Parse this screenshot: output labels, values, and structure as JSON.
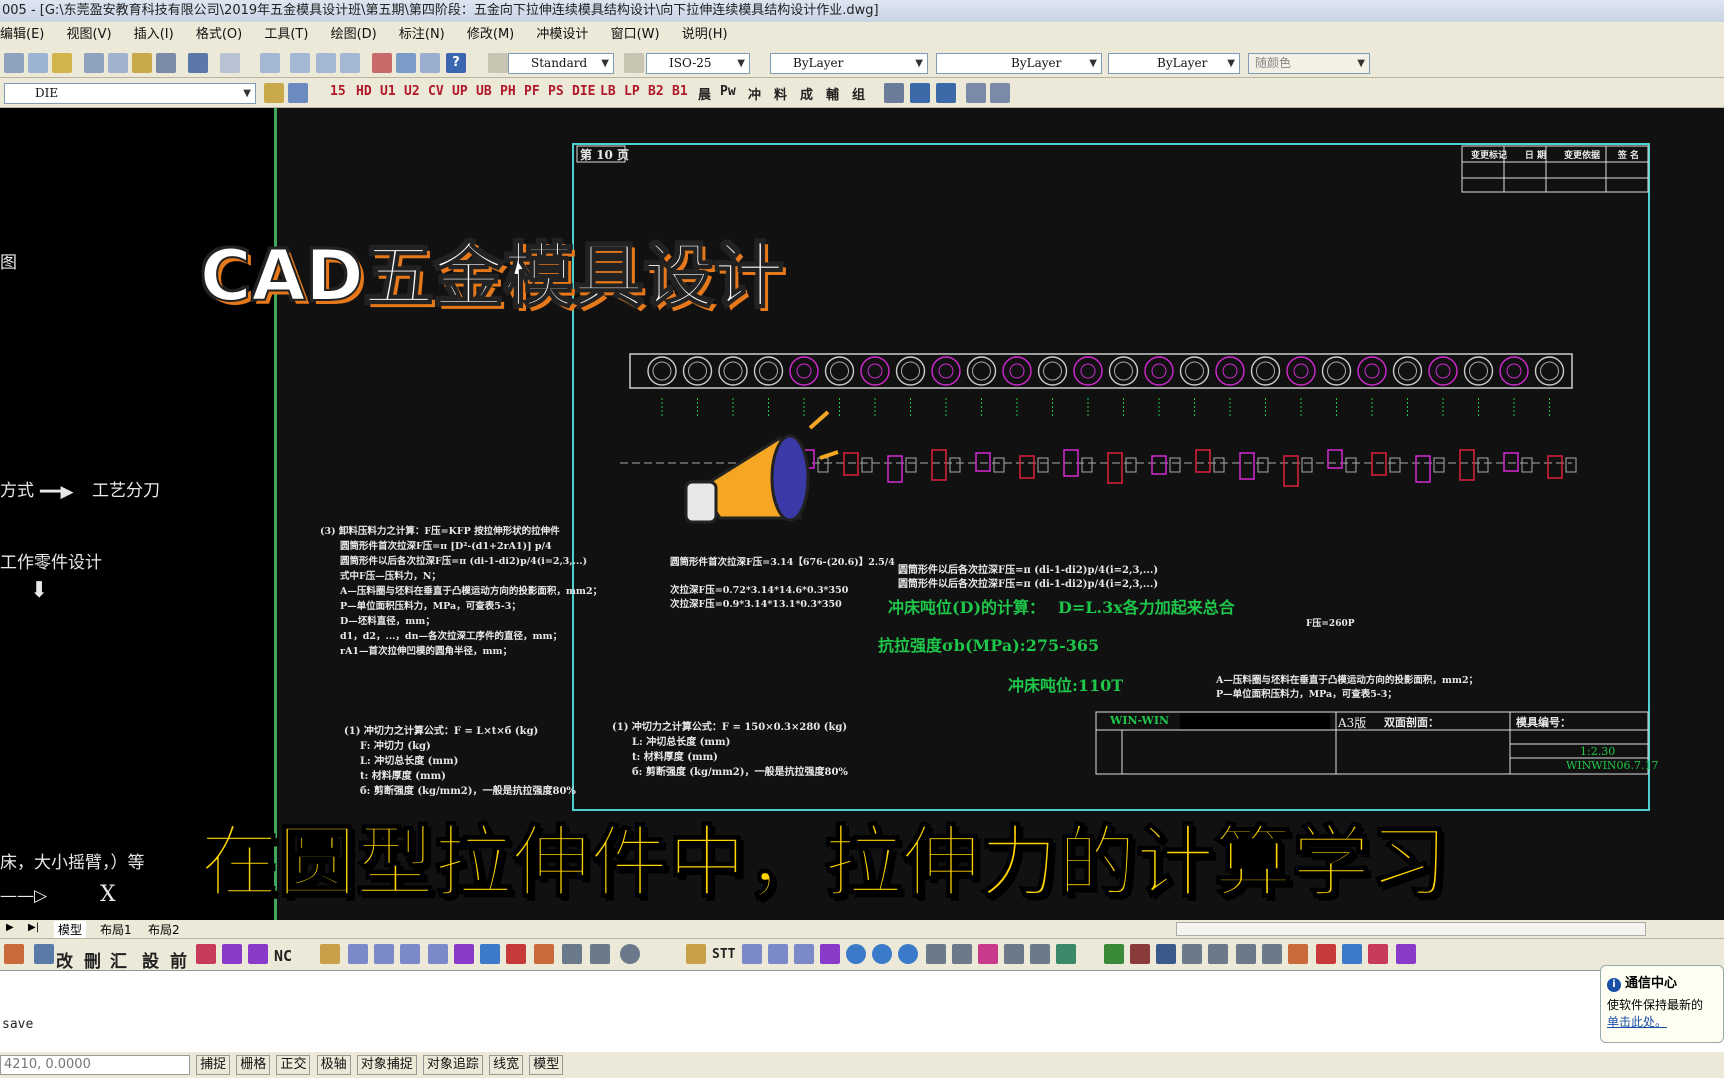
{
  "window": {
    "title": "005 - [G:\\东莞盈安教育科技有限公司\\2019年五金模具设计班\\第五期\\第四阶段：五金向下拉伸连续模具结构设计\\向下拉伸连续模具结构设计作业.dwg]"
  },
  "menu": [
    "编辑(E)",
    "视图(V)",
    "插入(I)",
    "格式(O)",
    "工具(T)",
    "绘图(D)",
    "标注(N)",
    "修改(M)",
    "冲模设计",
    "窗口(W)",
    "说明(H)"
  ],
  "toolbar": {
    "text_style": "Standard",
    "dim_style": "ISO-25",
    "layer_color": "ByLayer",
    "linetype": "ByLayer",
    "lineweight": "ByLayer",
    "plot_color": "随颜色",
    "layer": "DIE"
  },
  "die_buttons": [
    "15",
    "HD",
    "U1",
    "U2",
    "CV",
    "UP",
    "UB",
    "PH",
    "PF",
    "PS",
    "DIE",
    "LB",
    "LP",
    "B2",
    "B1",
    "晨",
    "Pw",
    "冲",
    "料",
    "成",
    "輔",
    "组"
  ],
  "bottom_die_buttons": [
    "改",
    "刪",
    "汇",
    "設",
    "前",
    "NC",
    "STT"
  ],
  "left_panel": {
    "item1": "方式",
    "item1_arrow": "工艺分刀",
    "item2": "工作零件设计",
    "item3": "床，大小摇臂，）等",
    "axis_x": "X",
    "mark": "图"
  },
  "drawing": {
    "page_label": "第 10 页",
    "rev_header": [
      "变更标记",
      "日 期",
      "变更依据",
      "签 名"
    ],
    "formula_left": [
      "(3) 卸料压料力之计算：F压=KFP 按拉伸形状的拉伸件",
      "圆筒形件首次拉深F压=π [D²-(d1+2rA1)] p/4",
      "圆筒形件以后各次拉深F压=π (di-1-di2)p/4(i=2,3,...)",
      "式中F压—压料力，N；",
      "A—压料圈与坯料在垂直于凸模运动方向的投影面积，mm2；",
      "P—单位面积压料力，MPa，可查表5-3；",
      "D—坯料直径，mm；",
      "d1，d2，...，dn—各次拉深工序件的直径，mm；",
      "rA1—首次拉伸凹模的圆角半径，mm；"
    ],
    "formula_cut1": [
      "(1) 冲切力之计算公式：F = L×t×б (kg)",
      "F: 冲切力 (kg)",
      "L: 冲切总长度 (mm)",
      "t: 材料厚度 (mm)",
      "б: 剪断强度 (kg/mm2)，一般是抗拉强度80%"
    ],
    "formula_cut2": [
      "(1) 冲切力之计算公式：F = 150×0.3×280 (kg)",
      "L: 冲切总长度 (mm)",
      "t: 材料厚度 (mm)",
      "б: 剪断强度 (kg/mm2)，一般是抗拉强度80%"
    ],
    "calc_lines": [
      "圆筒形件首次拉深F压=3.14【676-(20.6)】2.5/4",
      "次拉深F压=0.72*3.14*14.6*0.3*350",
      "次拉深F压=0.9*3.14*13.1*0.3*350",
      "圆筒形件以后各次拉深F压=π (di-1-di2)p/4(i=2,3,...)",
      "圆筒形件以后各次拉深F压=π (di-1-di2)p/4(i=2,3,...)"
    ],
    "green_calc": "冲床吨位(D)的计算：",
    "green_formula": "D=L.3x各力加起来总合",
    "green_strength": "抗拉强度σb(MPa):275-365",
    "green_tonnage": "冲床吨位:110T",
    "f_label": "F压=260P",
    "area_note": [
      "A—压料圈与坯料在垂直于凸模运动方向的投影面积，mm2；",
      "P—单位面积压料力，MPa，可查表5-3；"
    ],
    "title_block": {
      "company": "WIN-WIN",
      "size": "A3版",
      "drawing_name": "双面剖面：",
      "mold_no": "模具编号：",
      "row1": "1:2.30",
      "row2": "WINWIN06.7.17"
    }
  },
  "overlay": {
    "title": "CAD五金模具设计",
    "subtitle": "在圆型拉伸件中，拉伸力的计算学习"
  },
  "tabs": [
    "模型",
    "布局1",
    "布局2"
  ],
  "command": {
    "line": "save"
  },
  "coords": "4210, 0.0000",
  "status_buttons": [
    "捕捉",
    "栅格",
    "正交",
    "极轴",
    "对象捕捉",
    "对象追踪",
    "线宽",
    "模型"
  ],
  "toast": {
    "title": "通信中心",
    "text": "使软件保持最新的",
    "link": "单击此处。"
  },
  "colors": {
    "accent_green": "#1ec64a",
    "cyan_frame": "#4fd0d0",
    "magenta": "#d42ad4",
    "red": "#e0213a",
    "subtitle_yellow": "#ffd400"
  }
}
